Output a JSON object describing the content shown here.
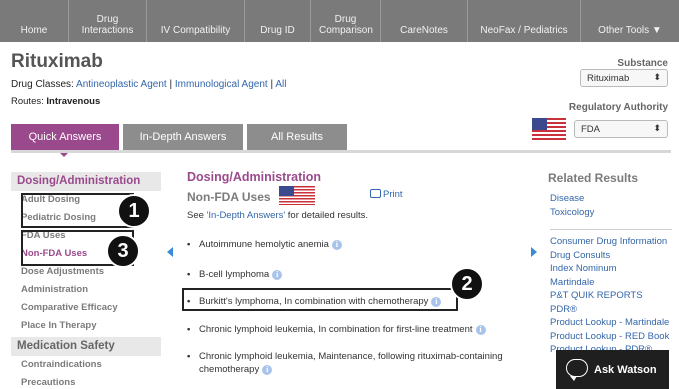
{
  "nav": {
    "items": [
      {
        "line1": "",
        "line2": "Home"
      },
      {
        "line1": "Drug",
        "line2": "Interactions"
      },
      {
        "line1": "",
        "line2": "IV Compatibility"
      },
      {
        "line1": "",
        "line2": "Drug ID"
      },
      {
        "line1": "Drug",
        "line2": "Comparison"
      },
      {
        "line1": "",
        "line2": "CareNotes"
      },
      {
        "line1": "",
        "line2": "NeoFax / Pediatrics"
      },
      {
        "line1": "",
        "line2": "Other Tools ▼"
      }
    ]
  },
  "header": {
    "title": "Rituximab",
    "drug_classes_label": "Drug Classes:",
    "drug_classes": [
      "Antineoplastic Agent",
      "Immunological Agent",
      "All"
    ],
    "separator": "|",
    "routes_label": "Routes:",
    "routes_value": "Intravenous",
    "substance_label": "Substance",
    "substance_value": "Rituximab",
    "regulatory_label": "Regulatory Authority",
    "regulatory_value": "FDA",
    "select_arrow": "⬍"
  },
  "tabs": [
    {
      "label": "Quick Answers",
      "active": true
    },
    {
      "label": "In-Depth Answers",
      "active": false
    },
    {
      "label": "All Results",
      "active": false
    }
  ],
  "sidebar": {
    "section1": {
      "heading": "Dosing/Administration",
      "items": [
        "Adult Dosing",
        "Pediatric Dosing",
        "FDA Uses",
        "Non-FDA Uses",
        "Dose Adjustments",
        "Administration",
        "Comparative Efficacy",
        "Place In Therapy"
      ],
      "active_index": 3
    },
    "section2": {
      "heading": "Medication Safety",
      "items": [
        "Contraindications",
        "Precautions"
      ]
    }
  },
  "annotations": [
    "1",
    "2",
    "3"
  ],
  "main": {
    "title": "Dosing/Administration",
    "subtitle": "Non-FDA Uses",
    "print_label": "Print",
    "see_prefix": "See ",
    "see_link": "'In-Depth Answers'",
    "see_suffix": " for detailed results.",
    "uses": [
      "Autoimmune hemolytic anemia",
      "B-cell lymphoma",
      "Burkitt's lymphoma, In combination with chemotherapy",
      "Chronic lymphoid leukemia, In combination for first-line treatment",
      "Chronic lymphoid leukemia, Maintenance, following rituximab-containing chemotherapy"
    ],
    "bullet": "•",
    "info_glyph": "i"
  },
  "related": {
    "title": "Related Results",
    "group1": [
      "Disease",
      "Toxicology"
    ],
    "group2": [
      "Consumer Drug Information",
      "Drug Consults",
      "Index Nominum",
      "Martindale",
      "P&T QUIK REPORTS",
      "PDR®",
      "Product Lookup - Martindale",
      "Product Lookup - RED Book",
      "Product Lookup - PDR®"
    ]
  },
  "watson": {
    "label": "Ask Watson"
  },
  "colors": {
    "accent": "#9a4a8c",
    "nav_bg": "#7a7a7a",
    "link": "#3366aa",
    "tab_inactive": "#8d8d8d"
  }
}
